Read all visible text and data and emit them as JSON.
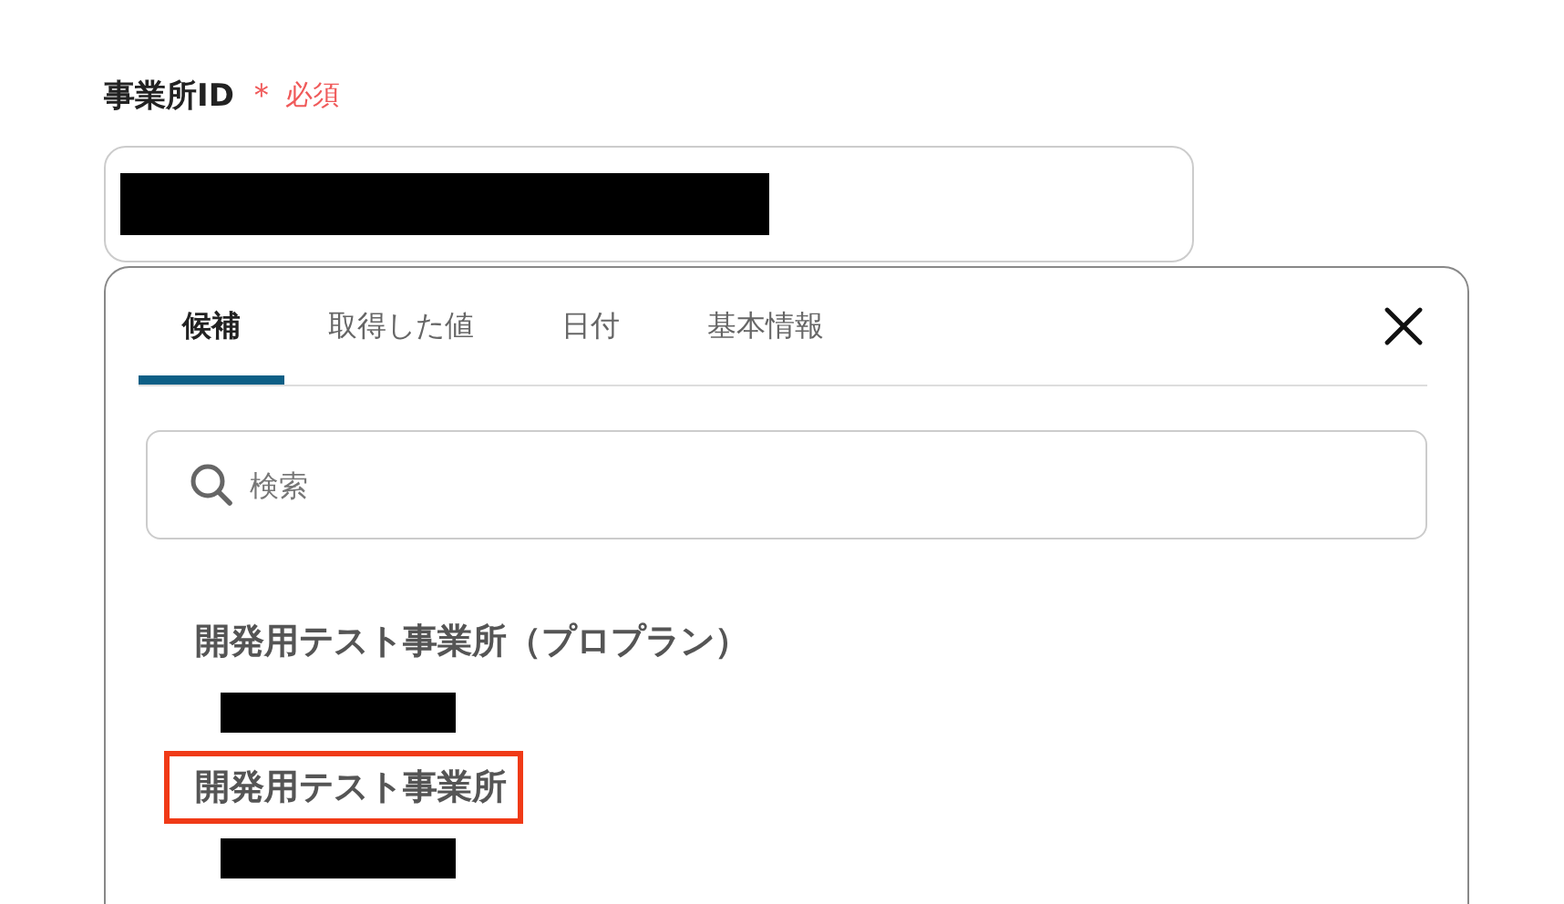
{
  "field": {
    "label": "事業所ID",
    "required_mark": "＊",
    "required_text": "必須",
    "value_redacted": true
  },
  "popup": {
    "tabs": [
      {
        "label": "候補",
        "selected": true
      },
      {
        "label": "取得した値",
        "selected": false
      },
      {
        "label": "日付",
        "selected": false
      },
      {
        "label": "基本情報",
        "selected": false
      }
    ],
    "search": {
      "placeholder": "検索"
    },
    "options": [
      {
        "name": "開発用テスト事業所（プロプラン）",
        "id_redacted": true,
        "highlighted": false
      },
      {
        "name": "開発用テスト事業所",
        "id_redacted": true,
        "highlighted": true
      }
    ]
  }
}
